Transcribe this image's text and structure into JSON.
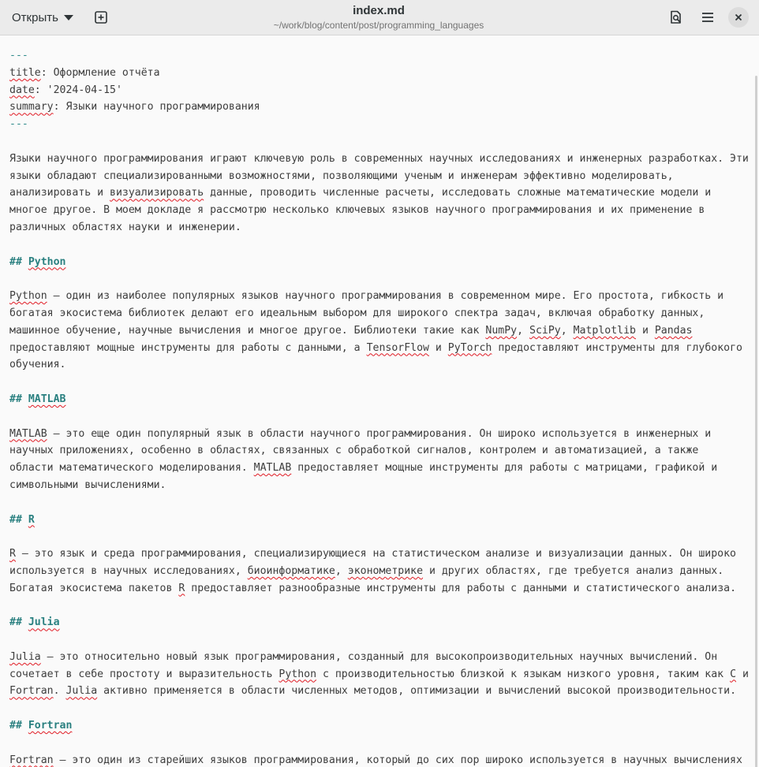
{
  "header": {
    "open_label": "Открыть",
    "title": "index.md",
    "subtitle": "~/work/blog/content/post/programming_languages"
  },
  "doc": {
    "fm_sep": "---",
    "fm_title_key": "title",
    "fm_title_val": ": Оформление отчёта",
    "fm_date_key": "date",
    "fm_date_val": ": '2024-04-15'",
    "fm_summary_key": "summary",
    "fm_summary_val": ": Языки научного программирования",
    "hash": "## ",
    "intro_1": "Языки научного программирования играют ключевую роль в современных научных исследованиях и инженерных разработках. Эти",
    "intro_2": "языки обладают специализированными возможностями, позволяющими ученым и инженерам эффективно моделировать,",
    "intro_3a": "анализировать и ",
    "intro_3b": "визуализировать",
    "intro_3c": " данные, проводить численные расчеты, исследовать сложные математические модели и",
    "intro_4": "многое другое. В моем докладе я рассмотрю несколько ключевых языков научного программирования и их применение в",
    "intro_5": "различных областях науки и инженерии.",
    "h_python": "Python",
    "py_1a": "Python",
    "py_1b": " — один из наиболее популярных языков научного программирования в современном мире. Его простота, гибкость и",
    "py_2": "богатая экосистема библиотек делают его идеальным выбором для широкого спектра задач, включая обработку данных,",
    "py_3a": "машинное обучение, научные вычисления и многое другое. Библиотеки такие как ",
    "py_3b": "NumPy",
    "py_3c": ", ",
    "py_3d": "SciPy",
    "py_3e": ", ",
    "py_3f": "Matplotlib",
    "py_3g": " и ",
    "py_3h": "Pandas",
    "py_4a": "предоставляют мощные инструменты для работы с данными, а ",
    "py_4b": "TensorFlow",
    "py_4c": " и ",
    "py_4d": "PyTorch",
    "py_4e": " предоставляют инструменты для глубокого",
    "py_5": "обучения.",
    "h_matlab": "MATLAB",
    "ml_1a": "MATLAB",
    "ml_1b": " — это еще один популярный язык в области научного программирования. Он широко используется в инженерных и",
    "ml_2": "научных приложениях, особенно в областях, связанных с обработкой сигналов, контролем и автоматизацией, а также",
    "ml_3a": "области математического моделирования. ",
    "ml_3b": "MATLAB",
    "ml_3c": " предоставляет мощные инструменты для работы с матрицами, графикой и",
    "ml_4": "символьными вычислениями.",
    "h_r": "R",
    "r_1a": "R",
    "r_1b": " — это язык и среда программирования, специализирующиеся на статистическом анализе и визуализации данных. Он широко",
    "r_2a": "используется в научных исследованиях, ",
    "r_2b": "биоинформатике",
    "r_2c": ", ",
    "r_2d": "эконометрике",
    "r_2e": " и других областях, где требуется анализ данных.",
    "r_3a": "Богатая экосистема пакетов ",
    "r_3b": "R",
    "r_3c": " предоставляет разнообразные инструменты для работы с данными и статистического анализа.",
    "h_julia": "Julia",
    "jl_1a": "Julia",
    "jl_1b": " — это относительно новый язык программирования, созданный для высокопроизводительных научных вычислений. Он",
    "jl_2a": "сочетает в себе простоту и выразительность ",
    "jl_2b": "Python",
    "jl_2c": " с производительностью близкой к языкам низкого уровня, таким как ",
    "jl_2d": "C",
    "jl_2e": " и",
    "jl_3a": "Fortran",
    "jl_3b": ". ",
    "jl_3c": "Julia",
    "jl_3d": " активно применяется в области численных методов, оптимизации и вычислений высокой производительности.",
    "h_fortran": "Fortran",
    "ft_1a": "Fortran",
    "ft_1b": " — это один из старейших языков программирования, который до сих пор широко используется в научных вычислениях"
  }
}
